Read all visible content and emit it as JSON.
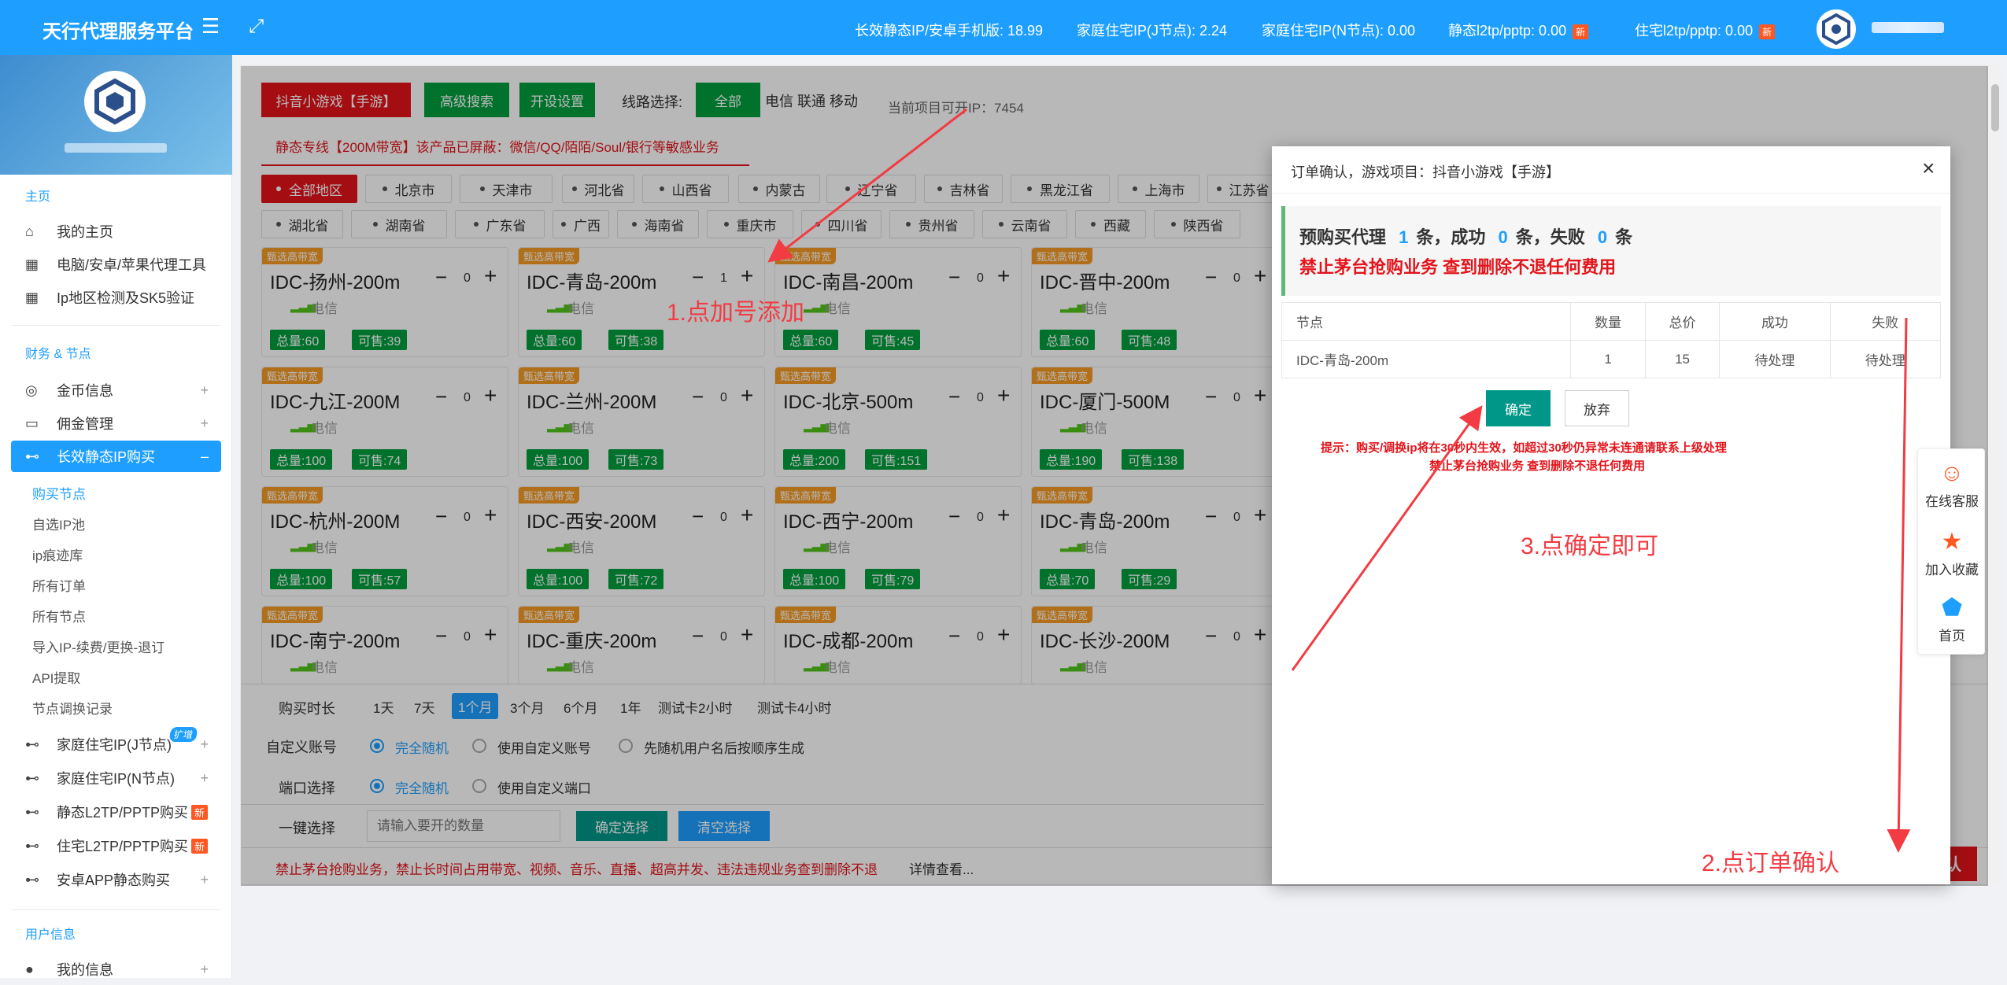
{
  "topbar": {
    "brand": "天行代理服务平台",
    "stats": [
      {
        "label": "长效静态IP/安卓手机版: 18.99",
        "new": ""
      },
      {
        "label": "家庭住宅IP(J节点): 2.24",
        "new": ""
      },
      {
        "label": "家庭住宅IP(N节点): 0.00",
        "new": ""
      },
      {
        "label": "静态l2tp/pptp: 0.00",
        "new": "新"
      },
      {
        "label": "住宅l2tp/pptp: 0.00",
        "new": "新"
      }
    ]
  },
  "sidebar": {
    "sections": [
      "主页",
      "财务 & 节点",
      "用户信息"
    ],
    "home_items": [
      "我的主页",
      "电脑/安卓/苹果代理工具",
      "Ip地区检测及SK5验证"
    ],
    "finance_items": [
      "金币信息",
      "佣金管理",
      "长效静态IP购买"
    ],
    "sub_items": [
      "购买节点",
      "自选IP池",
      "ip痕迹库",
      "所有订单",
      "所有节点",
      "导入IP-续费/更换-退订",
      "API提取",
      "节点调换记录"
    ],
    "more_items": [
      {
        "label": "家庭住宅IP(J节点)",
        "badge": "扩增"
      },
      {
        "label": "家庭住宅IP(N节点)",
        "badge": ""
      },
      {
        "label": "静态L2TP/PPTP购买",
        "badge": "新"
      },
      {
        "label": "住宅L2TP/PPTP购买",
        "badge": "新"
      },
      {
        "label": "安卓APP静态购买",
        "badge": ""
      }
    ],
    "user_items": [
      "我的信息"
    ]
  },
  "toolbar": {
    "project_btn": "抖音小游戏【手游】",
    "adv_search": "高级搜索",
    "open_settings": "开设设置",
    "line_label": "线路选择:",
    "line_all": "全部",
    "lines": "电信 联通 移动",
    "available": "当前项目可开IP：7454",
    "notice": "静态专线【200M带宽】该产品已屏蔽：微信/QQ/陌陌/Soul/银行等敏感业务"
  },
  "regions_row1": [
    "全部地区",
    "北京市",
    "天津市",
    "河北省",
    "山西省",
    "内蒙古",
    "辽宁省",
    "吉林省",
    "黑龙江省",
    "上海市",
    "江苏省"
  ],
  "regions_row2": [
    "湖北省",
    "湖南省",
    "广东省",
    "广西",
    "海南省",
    "重庆市",
    "四川省",
    "贵州省",
    "云南省",
    "西藏",
    "陕西省"
  ],
  "cards": [
    {
      "tag": "甄选高带宽",
      "name": "IDC-扬州-200m",
      "qty": "0",
      "isp": "电信",
      "total": "总量:60",
      "sell": "可售:39"
    },
    {
      "tag": "甄选高带宽",
      "name": "IDC-青岛-200m",
      "qty": "1",
      "isp": "电信",
      "total": "总量:60",
      "sell": "可售:38"
    },
    {
      "tag": "甄选高带宽",
      "name": "IDC-南昌-200m",
      "qty": "0",
      "isp": "电信",
      "total": "总量:60",
      "sell": "可售:45"
    },
    {
      "tag": "甄选高带宽",
      "name": "IDC-晋中-200m",
      "qty": "0",
      "isp": "电信",
      "total": "总量:60",
      "sell": "可售:48"
    },
    {
      "tag": "甄选高带宽",
      "name": "IDC-九江-200M",
      "qty": "0",
      "isp": "电信",
      "total": "总量:100",
      "sell": "可售:74"
    },
    {
      "tag": "甄选高带宽",
      "name": "IDC-兰州-200M",
      "qty": "0",
      "isp": "电信",
      "total": "总量:100",
      "sell": "可售:73"
    },
    {
      "tag": "甄选高带宽",
      "name": "IDC-北京-500m",
      "qty": "0",
      "isp": "电信",
      "total": "总量:200",
      "sell": "可售:151"
    },
    {
      "tag": "甄选高带宽",
      "name": "IDC-厦门-500M",
      "qty": "0",
      "isp": "电信",
      "total": "总量:190",
      "sell": "可售:138"
    },
    {
      "tag": "甄选高带宽",
      "name": "IDC-杭州-200M",
      "qty": "0",
      "isp": "电信",
      "total": "总量:100",
      "sell": "可售:57"
    },
    {
      "tag": "甄选高带宽",
      "name": "IDC-西安-200M",
      "qty": "0",
      "isp": "电信",
      "total": "总量:100",
      "sell": "可售:72"
    },
    {
      "tag": "甄选高带宽",
      "name": "IDC-西宁-200m",
      "qty": "0",
      "isp": "电信",
      "total": "总量:100",
      "sell": "可售:79"
    },
    {
      "tag": "甄选高带宽",
      "name": "IDC-青岛-200m",
      "qty": "0",
      "isp": "电信",
      "total": "总量:70",
      "sell": "可售:29"
    },
    {
      "tag": "甄选高带宽",
      "name": "IDC-南宁-200m",
      "qty": "0",
      "isp": "电信",
      "total": "",
      "sell": ""
    },
    {
      "tag": "甄选高带宽",
      "name": "IDC-重庆-200m",
      "qty": "0",
      "isp": "电信",
      "total": "",
      "sell": ""
    },
    {
      "tag": "甄选高带宽",
      "name": "IDC-成都-200m",
      "qty": "0",
      "isp": "电信",
      "total": "",
      "sell": ""
    },
    {
      "tag": "甄选高带宽",
      "name": "IDC-长沙-200M",
      "qty": "0",
      "isp": "电信",
      "total": "",
      "sell": ""
    }
  ],
  "purchase": {
    "duration_label": "购买时长",
    "durations": [
      "1天",
      "7天",
      "1个月",
      "3个月",
      "6个月",
      "1年",
      "测试卡2小时",
      "测试卡4小时"
    ],
    "account_label": "自定义账号",
    "account_opts": [
      "完全随机",
      "使用自定义账号",
      "先随机用户名后按顺序生成"
    ],
    "port_label": "端口选择",
    "port_opts": [
      "完全随机",
      "使用自定义端口"
    ],
    "quick_label": "一键选择",
    "quick_placeholder": "请输入要开的数量",
    "confirm_select": "确定选择",
    "clear_select": "清空选择",
    "footer_warn": "禁止茅台抢购业务，禁止长时间占用带宽、视频、音乐、直播、超高并发、违法违规业务查到删除不退",
    "detail": "详情查看...",
    "order_confirm": "订单确认"
  },
  "modal": {
    "title": "订单确认，游戏项目：抖音小游戏【手游】",
    "close": "×",
    "summary_a": "预购买代理",
    "summary_n1": "1",
    "summary_b": "条，成功",
    "summary_n2": "0",
    "summary_c": "条，失败",
    "summary_n3": "0",
    "summary_d": "条",
    "warn": "禁止茅台抢购业务 查到删除不退任何费用",
    "columns": [
      "节点",
      "数量",
      "总价",
      "成功",
      "失败"
    ],
    "rows": [
      [
        "IDC-青岛-200m",
        "1",
        "15",
        "待处理",
        "待处理"
      ]
    ],
    "confirm": "确定",
    "cancel": "放弃",
    "tip1": "提示：购买/调换ip将在30秒内生效，如超过30秒仍异常未连通请联系上级处理",
    "tip2": "禁止茅台抢购业务 查到删除不退任何费用"
  },
  "float": [
    "在线客服",
    "加入收藏",
    "首页"
  ],
  "annotations": [
    "1.点加号添加",
    "2.点订单确认",
    "3.点确定即可"
  ]
}
